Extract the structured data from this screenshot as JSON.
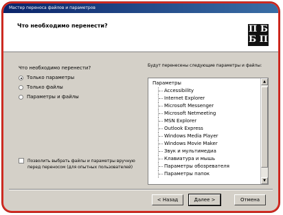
{
  "window": {
    "title": "Мастер переноса файлов и параметров"
  },
  "header": {
    "question": "Что необходимо перенести?",
    "logo_text": "П Б\nБ П"
  },
  "left": {
    "label": "Что необходимо перенести?",
    "options": [
      {
        "label": "Только параметры",
        "selected": true
      },
      {
        "label": "Только файлы",
        "selected": false
      },
      {
        "label": "Параметры и файлы",
        "selected": false
      }
    ],
    "checkbox": {
      "checked": false,
      "label": "Позволить выбрать файлы и параметры вручную перед переносом (для опытных пользователей)"
    }
  },
  "right": {
    "label": "Будут перенесены следующие параметры и файлы:",
    "list": {
      "root": "Параметры",
      "items": [
        "Accessibility",
        "Internet Explorer",
        "Microsoft Messenger",
        "Microsoft Netmeeting",
        "MSN Explorer",
        "Outlook Express",
        "Windows Media Player",
        "Windows Movie Maker",
        "Звук и мультимедиа",
        "Клавиатура и мышь",
        "Параметры обозревателя",
        "Параметры папок"
      ]
    }
  },
  "buttons": {
    "back": "< Назад",
    "next": "Далее >",
    "cancel": "Отмена"
  }
}
